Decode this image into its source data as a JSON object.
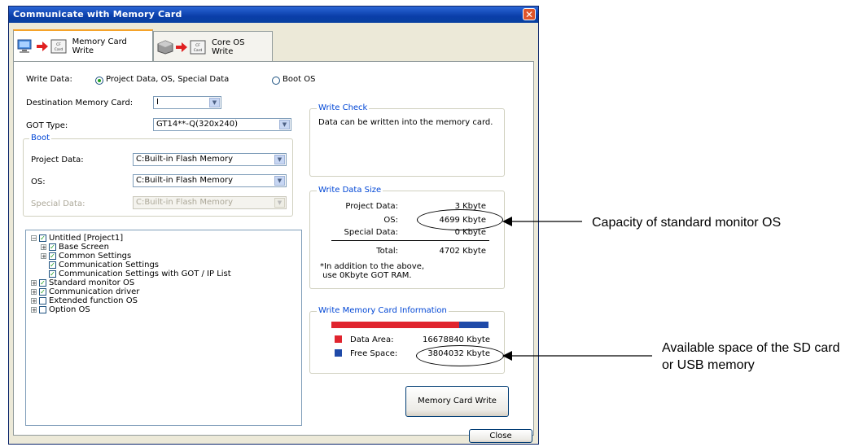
{
  "window": {
    "title": "Communicate with Memory Card",
    "close_glyph": "✕"
  },
  "tabs": [
    {
      "label": "Memory Card Write",
      "active": true
    },
    {
      "label": "Core OS Write",
      "active": false
    }
  ],
  "icons": {
    "memory_card_text": "CF\nCard"
  },
  "write_data": {
    "label": "Write Data:",
    "option1": "Project Data, OS, Special Data",
    "option2": "Boot OS",
    "selected": "option1"
  },
  "destination": {
    "label": "Destination Memory Card:",
    "value": "I"
  },
  "got_type": {
    "label": "GOT Type:",
    "value": "GT14**-Q(320x240)"
  },
  "boot": {
    "title": "Boot",
    "project_label": "Project Data:",
    "project_value": "C:Built-in Flash Memory",
    "os_label": "OS:",
    "os_value": "C:Built-in Flash Memory",
    "special_label": "Special Data:",
    "special_value": "C:Built-in Flash Memory"
  },
  "write_check": {
    "title": "Write Check",
    "message": "Data can be written into the memory card."
  },
  "write_data_size": {
    "title": "Write Data Size",
    "project_label": "Project Data:",
    "project_value": "3 Kbyte",
    "os_label": "OS:",
    "os_value": "4699 Kbyte",
    "special_label": "Special Data:",
    "special_value": "0 Kbyte",
    "total_label": "Total:",
    "total_value": "4702 Kbyte",
    "note": "*In addition to the above,\n use 0Kbyte GOT RAM."
  },
  "memory_card_info": {
    "title": "Write Memory Card Information",
    "data_area_label": "Data Area:",
    "data_area_value": "16678840  Kbyte",
    "free_space_label": "Free Space:",
    "free_space_value": "3804032 Kbyte",
    "data_color": "#e0242e",
    "free_color": "#1f4aa8",
    "used_fraction": 0.814
  },
  "tree": [
    {
      "label": "Untitled [Project1]",
      "level": 0,
      "expander": "−",
      "checked": true
    },
    {
      "label": "Base Screen",
      "level": 1,
      "expander": "+",
      "checked": true
    },
    {
      "label": "Common Settings",
      "level": 1,
      "expander": "+",
      "checked": true
    },
    {
      "label": "Communication Settings",
      "level": 1,
      "expander": "",
      "checked": true
    },
    {
      "label": "Communication Settings with GOT / IP List",
      "level": 1,
      "expander": "",
      "checked": true
    },
    {
      "label": "Standard monitor OS",
      "level": 0,
      "expander": "+",
      "checked": true
    },
    {
      "label": "Communication driver",
      "level": 0,
      "expander": "+",
      "checked": true
    },
    {
      "label": "Extended function OS",
      "level": 0,
      "expander": "+",
      "checked": false
    },
    {
      "label": "Option OS",
      "level": 0,
      "expander": "+",
      "checked": false
    }
  ],
  "buttons": {
    "memory_card_write": "Memory Card Write",
    "close": "Close"
  },
  "annotations": {
    "os_capacity": "Capacity of standard monitor OS",
    "available_space_line1": "Available space of the SD card",
    "available_space_line2": "or USB memory"
  }
}
